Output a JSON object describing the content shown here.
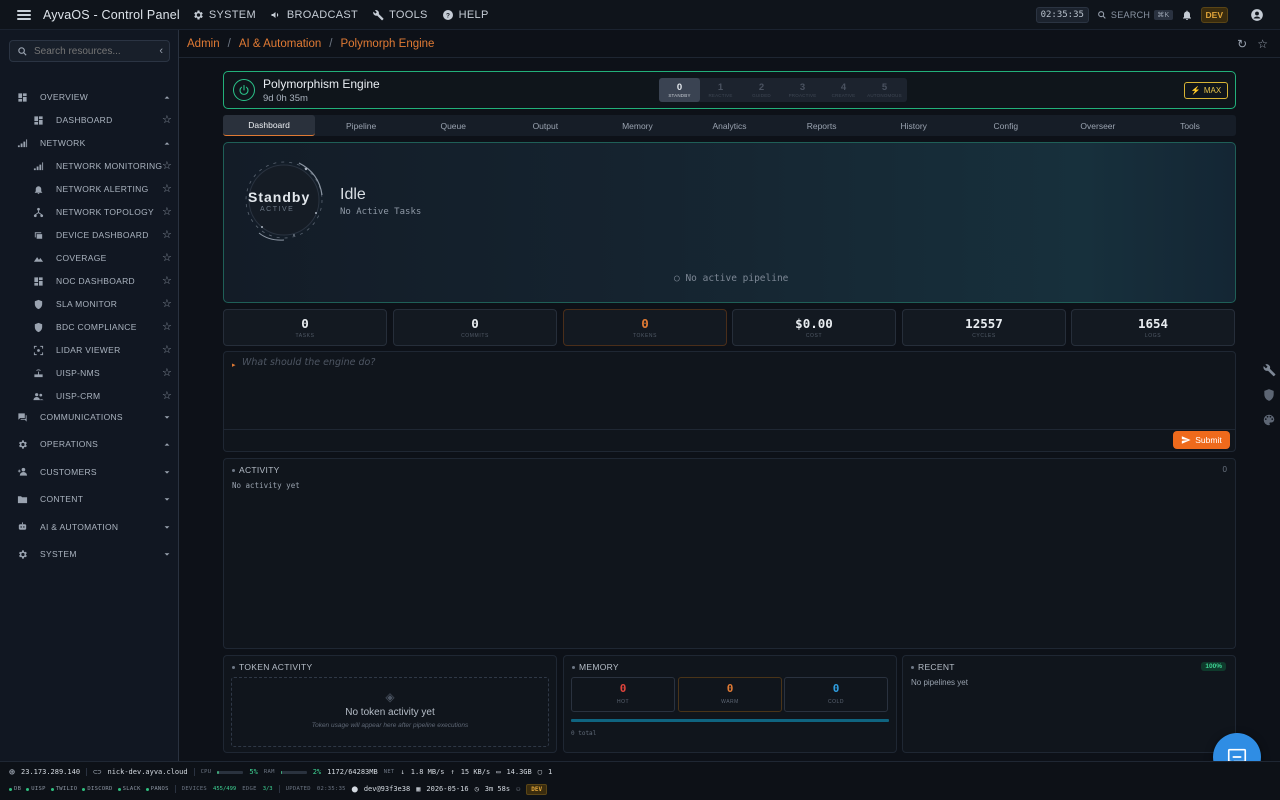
{
  "app": {
    "title": "AyvaOS - Control Panel"
  },
  "topnav": [
    {
      "label": "SYSTEM",
      "icon": "gear-icon"
    },
    {
      "label": "BROADCAST",
      "icon": "megaphone-icon"
    },
    {
      "label": "TOOLS",
      "icon": "wrench-icon"
    },
    {
      "label": "HELP",
      "icon": "help-icon"
    }
  ],
  "topbar": {
    "clock": "02:35:35",
    "search_label": "SEARCH",
    "search_shortcut": "⌘K",
    "env": "DEV"
  },
  "sidebar": {
    "search_placeholder": "Search resources...",
    "items": [
      {
        "label": "OVERVIEW",
        "icon": "dashboard-icon",
        "type": "group",
        "expanded": true
      },
      {
        "label": "DASHBOARD",
        "icon": "dashboard-icon",
        "type": "child"
      },
      {
        "label": "NETWORK",
        "icon": "signal-icon",
        "type": "group",
        "expanded": true
      },
      {
        "label": "NETWORK MONITORING",
        "icon": "signal-icon",
        "type": "child"
      },
      {
        "label": "NETWORK ALERTING",
        "icon": "bell-icon",
        "type": "child"
      },
      {
        "label": "NETWORK TOPOLOGY",
        "icon": "topology-icon",
        "type": "child"
      },
      {
        "label": "DEVICE DASHBOARD",
        "icon": "devices-icon",
        "type": "child"
      },
      {
        "label": "COVERAGE",
        "icon": "terrain-icon",
        "type": "child"
      },
      {
        "label": "NOC DASHBOARD",
        "icon": "dashboard-icon",
        "type": "child"
      },
      {
        "label": "SLA MONITOR",
        "icon": "shield-icon",
        "type": "child"
      },
      {
        "label": "BDC COMPLIANCE",
        "icon": "shield-icon",
        "type": "child"
      },
      {
        "label": "LIDAR VIEWER",
        "icon": "scan-icon",
        "type": "child"
      },
      {
        "label": "UISP-NMS",
        "icon": "router-icon",
        "type": "child"
      },
      {
        "label": "UISP-CRM",
        "icon": "people-icon",
        "type": "child"
      },
      {
        "label": "COMMUNICATIONS",
        "icon": "chat-icon",
        "type": "group",
        "expanded": false
      },
      {
        "label": "OPERATIONS",
        "icon": "gear-icon",
        "type": "group",
        "expanded": true
      },
      {
        "label": "CUSTOMERS",
        "icon": "person-add-icon",
        "type": "group",
        "expanded": false
      },
      {
        "label": "CONTENT",
        "icon": "folder-icon",
        "type": "group",
        "expanded": false
      },
      {
        "label": "AI & AUTOMATION",
        "icon": "robot-icon",
        "type": "group",
        "expanded": false
      },
      {
        "label": "SYSTEM",
        "icon": "gear-icon",
        "type": "group",
        "expanded": false
      }
    ]
  },
  "breadcrumb": [
    "Admin",
    "AI & Automation",
    "Polymorph Engine"
  ],
  "engine": {
    "name": "Polymorphism Engine",
    "uptime": "9d 0h 35m",
    "modes": [
      {
        "num": "0",
        "label": "STANDBY",
        "active": true
      },
      {
        "num": "1",
        "label": "REACTIVE"
      },
      {
        "num": "2",
        "label": "GUIDED"
      },
      {
        "num": "3",
        "label": "PROACTIVE"
      },
      {
        "num": "4",
        "label": "CREATIVE"
      },
      {
        "num": "5",
        "label": "AUTONOMOUS"
      }
    ],
    "max_label": "MAX"
  },
  "tabs": [
    "Dashboard",
    "Pipeline",
    "Queue",
    "Output",
    "Memory",
    "Analytics",
    "Reports",
    "History",
    "Config",
    "Overseer",
    "Tools"
  ],
  "hero": {
    "orb_label": "Standby",
    "orb_sub": "ACTIVE",
    "title": "Idle",
    "subtitle": "No Active Tasks",
    "pipeline": "○ No active pipeline"
  },
  "stats": [
    {
      "value": "0",
      "label": "TASKS"
    },
    {
      "value": "0",
      "label": "COMMITS"
    },
    {
      "value": "0",
      "label": "TOKENS",
      "accent": "#e07a34"
    },
    {
      "value": "$0.00",
      "label": "COST"
    },
    {
      "value": "12557",
      "label": "CYCLES"
    },
    {
      "value": "1654",
      "label": "LOGS"
    }
  ],
  "prompt": {
    "placeholder": "What should the engine do?",
    "submit_label": "Submit"
  },
  "activity": {
    "title": "ACTIVITY",
    "count": "0",
    "empty": "No activity yet"
  },
  "token_activity": {
    "title": "TOKEN ACTIVITY",
    "empty_title": "No token activity yet",
    "empty_sub": "Token usage will appear here after pipeline executions"
  },
  "memory": {
    "title": "MEMORY",
    "boxes": [
      {
        "value": "0",
        "label": "HOT",
        "color": "#e0443c"
      },
      {
        "value": "0",
        "label": "WARM",
        "color": "#e07a34"
      },
      {
        "value": "0",
        "label": "COLD",
        "color": "#2f9ee0"
      }
    ],
    "total": "0 total"
  },
  "recent": {
    "title": "RECENT",
    "badge": "100%",
    "empty": "No pipelines yet"
  },
  "status": {
    "ip": "23.173.289.140",
    "host": "nick-dev.ayva.cloud",
    "cpu_label": "CPU",
    "cpu_value": "5%",
    "cpu_fraction": 0.05,
    "ram_label": "RAM",
    "ram_value": "2%",
    "ram_fraction": 0.02,
    "ram_detail": "1172/64283MB",
    "net_label": "NET",
    "net_down": "1.8 MB/s",
    "net_up": "15 KB/s",
    "disk": "14.3GB",
    "screens": "1",
    "services": [
      "DB",
      "UISP",
      "TWILIO",
      "DISCORD",
      "SLACK",
      "PANOS"
    ],
    "devices_label": "DEVICES",
    "devices_value": "455/499",
    "edge_label": "EDGE",
    "edge_value": "3/3",
    "updated_label": "UPDATED",
    "updated_value": "02:35:35",
    "commit": "dev@93f3e38",
    "date": "2026-05-16",
    "duration": "3m 58s",
    "env": "DEV"
  },
  "colors": {
    "accent": "#e07a34",
    "success": "#2bc48a",
    "fab": "#2f8de4"
  }
}
